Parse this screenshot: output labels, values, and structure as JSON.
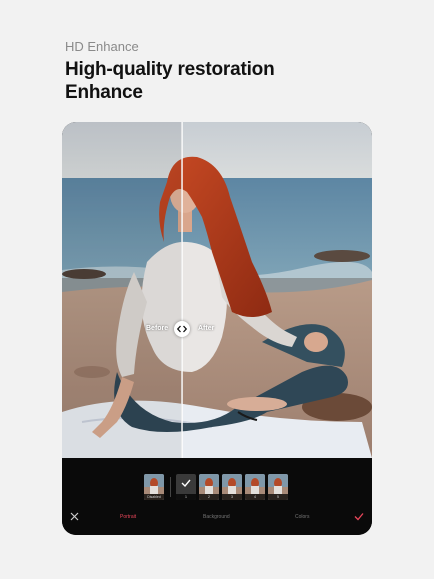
{
  "header": {
    "subtitle": "HD Enhance",
    "headline_line1": "High-quality restoration",
    "headline_line2": "Enhance"
  },
  "compare": {
    "before_label": "Before",
    "after_label": "After",
    "handle_icon": "left-right-arrows-icon"
  },
  "filters": [
    {
      "caption": "Disabled",
      "selected": false
    },
    {
      "caption": "1",
      "selected": true
    },
    {
      "caption": "2",
      "selected": false
    },
    {
      "caption": "3",
      "selected": false
    },
    {
      "caption": "4",
      "selected": false
    },
    {
      "caption": "5",
      "selected": false
    }
  ],
  "tabs": {
    "portrait": "Portrait",
    "background": "Background",
    "colors": "Colors"
  },
  "colors": {
    "accent": "#e8465a",
    "page_bg": "#f2f2f2",
    "toolbar_bg": "#0a0a0a"
  }
}
